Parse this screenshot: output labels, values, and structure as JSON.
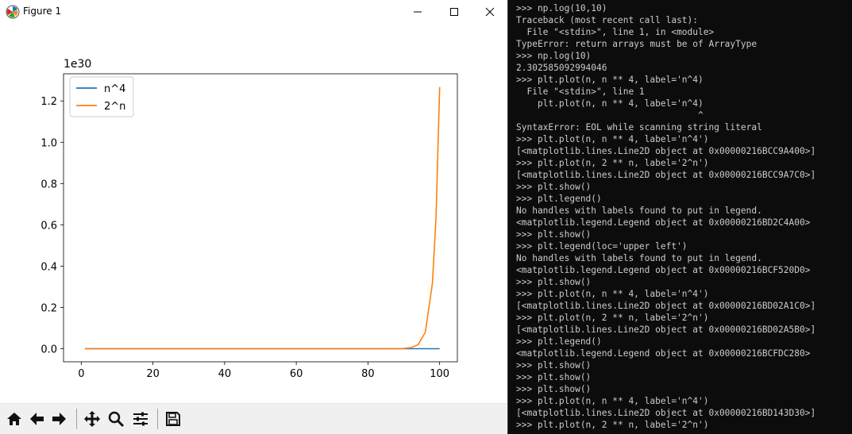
{
  "window": {
    "title": "Figure 1"
  },
  "chart_data": {
    "type": "line",
    "title": "",
    "xlabel": "",
    "ylabel": "",
    "offset_label": "1e30",
    "xlim": [
      -4.95,
      104.95
    ],
    "ylim": [
      -0.0634,
      1.3315
    ],
    "x_ticks": [
      0,
      20,
      40,
      60,
      80,
      100
    ],
    "y_ticks": [
      0.0,
      0.2,
      0.4,
      0.6,
      0.8,
      1.0,
      1.2
    ],
    "y_tick_labels": [
      "0.0",
      "0.2",
      "0.4",
      "0.6",
      "0.8",
      "1.0",
      "1.2"
    ],
    "legend": {
      "placement": "upper left",
      "entries": [
        "n^4",
        "2^n"
      ]
    },
    "series": [
      {
        "name": "n^4",
        "color": "#1f77b4",
        "x": [
          1,
          100
        ],
        "y": [
          0.0,
          0.0
        ]
      },
      {
        "name": "2^n",
        "color": "#ff7f0e",
        "x": [
          1,
          86,
          88,
          90,
          92,
          94,
          96,
          98,
          99,
          100
        ],
        "y": [
          0.0,
          0.0001,
          0.0003,
          0.0012,
          0.005,
          0.0198,
          0.0792,
          0.3169,
          0.6338,
          1.2677
        ]
      }
    ]
  },
  "toolbar": {
    "buttons": [
      "home-icon",
      "back-arrow-icon",
      "forward-arrow-icon",
      "pan-icon",
      "zoom-icon",
      "configure-subplots-icon",
      "save-icon"
    ]
  },
  "terminal": {
    "lines": [
      ">>> np.log(10,10)",
      "Traceback (most recent call last):",
      "  File \"<stdin>\", line 1, in <module>",
      "TypeError: return arrays must be of ArrayType",
      ">>> np.log(10)",
      "2.302585092994046",
      ">>> plt.plot(n, n ** 4, label='n^4)",
      "  File \"<stdin>\", line 1",
      "    plt.plot(n, n ** 4, label='n^4)",
      "                                  ^",
      "SyntaxError: EOL while scanning string literal",
      ">>> plt.plot(n, n ** 4, label='n^4')",
      "[<matplotlib.lines.Line2D object at 0x00000216BCC9A400>]",
      ">>> plt.plot(n, 2 ** n, label='2^n')",
      "[<matplotlib.lines.Line2D object at 0x00000216BCC9A7C0>]",
      ">>> plt.show()",
      ">>> plt.legend()",
      "No handles with labels found to put in legend.",
      "<matplotlib.legend.Legend object at 0x00000216BD2C4A00>",
      ">>> plt.show()",
      ">>> plt.legend(loc='upper left')",
      "No handles with labels found to put in legend.",
      "<matplotlib.legend.Legend object at 0x00000216BCF520D0>",
      ">>> plt.show()",
      ">>> plt.plot(n, n ** 4, label='n^4')",
      "[<matplotlib.lines.Line2D object at 0x00000216BD02A1C0>]",
      ">>> plt.plot(n, 2 ** n, label='2^n')",
      "[<matplotlib.lines.Line2D object at 0x00000216BD02A5B0>]",
      ">>> plt.legend()",
      "<matplotlib.legend.Legend object at 0x00000216BCFDC280>",
      ">>> plt.show()",
      ">>> plt.show()",
      ">>> plt.show()",
      ">>> plt.plot(n, n ** 4, label='n^4')",
      "[<matplotlib.lines.Line2D object at 0x00000216BD143D30>]",
      ">>> plt.plot(n, 2 ** n, label='2^n')"
    ]
  }
}
